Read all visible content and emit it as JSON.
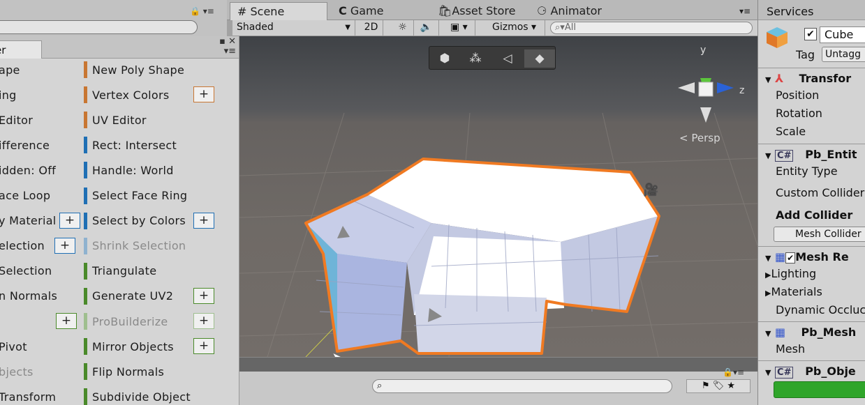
{
  "left_panel": {
    "tab_label": "er",
    "rows": [
      {
        "label": "ape",
        "color": "#c87632",
        "dim": false
      },
      {
        "label": "ing",
        "color": "#c87632",
        "dim": false
      },
      {
        "label": "Editor",
        "color": "#c87632",
        "dim": false
      },
      {
        "label": "ifference",
        "color": "#1f6fb4",
        "dim": false
      },
      {
        "label": "idden: Off",
        "color": "#1f6fb4",
        "dim": false
      },
      {
        "label": "ace Loop",
        "color": "#1f6fb4",
        "dim": false
      },
      {
        "label": "y Material",
        "color": "#1f6fb4",
        "dim": false
      },
      {
        "label": "election",
        "color": "#1f6fb4",
        "dim": false
      },
      {
        "label": "Selection",
        "color": "#1f6fb4",
        "dim": false
      },
      {
        "label": "n Normals",
        "color": "#4a8a2a",
        "dim": false
      },
      {
        "label": "",
        "color": "#4a8a2a",
        "dim": false
      },
      {
        "label": "Pivot",
        "color": "#4a8a2a",
        "dim": false
      },
      {
        "label": "bjects",
        "color": "#4a8a2a",
        "dim": true
      },
      {
        "label": "Transform",
        "color": "#4a8a2a",
        "dim": false
      }
    ],
    "right_rows": [
      {
        "label": "New Poly Shape",
        "color": "#c87632",
        "dim": false
      },
      {
        "label": "Vertex Colors",
        "color": "#c87632",
        "dim": false
      },
      {
        "label": "UV Editor",
        "color": "#c87632",
        "dim": false
      },
      {
        "label": "Rect: Intersect",
        "color": "#1f6fb4",
        "dim": false
      },
      {
        "label": "Handle: World",
        "color": "#1f6fb4",
        "dim": false
      },
      {
        "label": "Select Face Ring",
        "color": "#1f6fb4",
        "dim": false
      },
      {
        "label": "Select by Colors",
        "color": "#1f6fb4",
        "dim": false
      },
      {
        "label": "Shrink Selection",
        "color": "#8fb2cf",
        "dim": true
      },
      {
        "label": "Triangulate",
        "color": "#4a8a2a",
        "dim": false
      },
      {
        "label": "Generate UV2",
        "color": "#4a8a2a",
        "dim": false
      },
      {
        "label": "ProBuilderize",
        "color": "#9fbf8f",
        "dim": true
      },
      {
        "label": "Mirror Objects",
        "color": "#4a8a2a",
        "dim": false
      },
      {
        "label": "Flip Normals",
        "color": "#4a8a2a",
        "dim": false
      },
      {
        "label": "Subdivide Object",
        "color": "#4a8a2a",
        "dim": false
      }
    ],
    "plus_label": "+"
  },
  "tabs": {
    "scene": "Scene",
    "game": "Game",
    "asset_store": "Asset Store",
    "animator": "Animator"
  },
  "scene_toolbar": {
    "shading": "Shaded",
    "mode_2d": "2D",
    "gizmos": "Gizmos",
    "search_placeholder": "All"
  },
  "scene_view": {
    "persp_label": "Persp",
    "gizmo_y": "y",
    "gizmo_z": "z"
  },
  "inspector": {
    "services_tab": "Services",
    "object_name": "Cube",
    "tag_label": "Tag",
    "tag_value": "Untagg",
    "transform_header": "Transfor",
    "position": "Position",
    "rotation": "Rotation",
    "scale": "Scale",
    "entity_header": "Pb_Entit",
    "entity_type": "Entity Type",
    "custom_collider": "Custom Collider",
    "add_collider": "Add Collider",
    "mesh_collider": "Mesh Collider",
    "mesh_renderer_header": "Mesh Re",
    "lighting": "Lighting",
    "materials": "Materials",
    "dynamic_occlusion": "Dynamic Occluc",
    "pb_mesh_header": "Pb_Mesh",
    "mesh": "Mesh",
    "pb_object_header": "Pb_Obje"
  }
}
